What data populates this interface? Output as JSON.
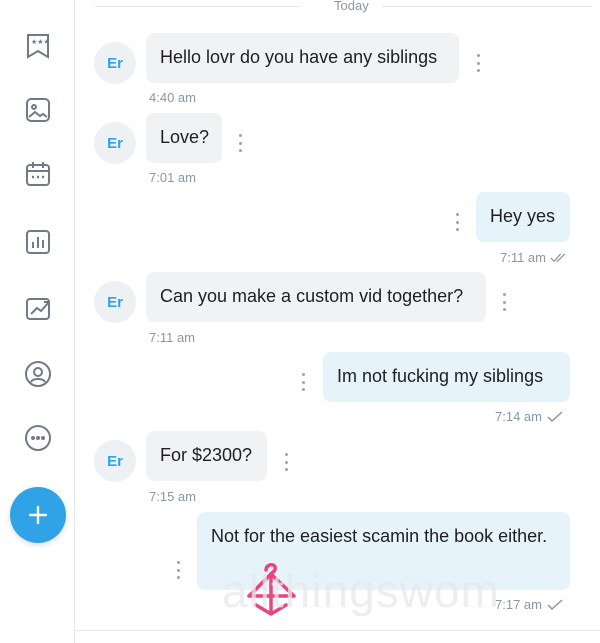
{
  "sidebar": {
    "icons": [
      "vault-stars-icon",
      "image-icon",
      "calendar-icon",
      "bar-chart-icon",
      "trending-icon",
      "profile-icon",
      "more-icon"
    ],
    "fab_icon": "plus-icon",
    "colors": {
      "accent": "#2fa3e6"
    }
  },
  "chat": {
    "date_divider": "Today",
    "messages": [
      {
        "direction": "in",
        "avatar": "Er",
        "text": "Hello lovr do you have any siblings",
        "time": "4:40 am"
      },
      {
        "direction": "in",
        "avatar": "Er",
        "text": "Love?",
        "time": "7:01 am"
      },
      {
        "direction": "out",
        "text": "Hey yes",
        "time": "7:11 am",
        "status": "read"
      },
      {
        "direction": "in",
        "avatar": "Er",
        "text": "Can you make a custom vid together?",
        "time": "7:11 am"
      },
      {
        "direction": "out",
        "text": "Im not fucking my siblings",
        "time": "7:14 am",
        "status": "sent"
      },
      {
        "direction": "in",
        "avatar": "Er",
        "text": "For $2300?",
        "time": "7:15 am"
      },
      {
        "direction": "out",
        "text": "Not for the easiest scamin the book either.",
        "time": "7:17 am",
        "status": "sent"
      }
    ]
  },
  "watermark": {
    "text": "allthingswom"
  }
}
